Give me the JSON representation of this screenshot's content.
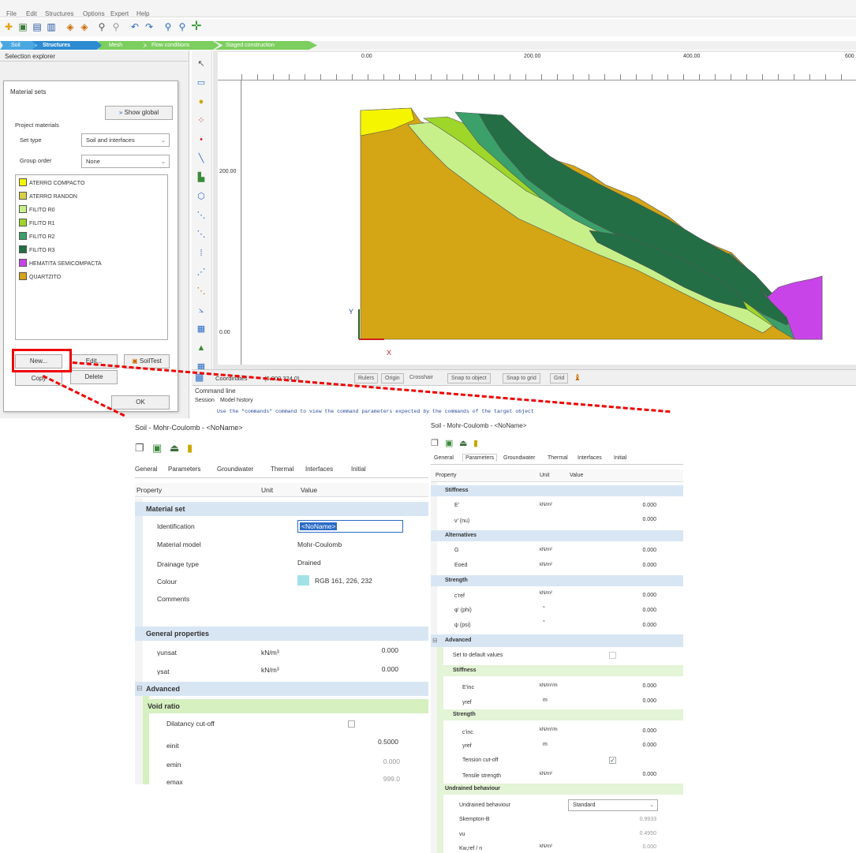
{
  "menu": [
    "File",
    "Edit",
    "Structures",
    "Options",
    "Expert",
    "Help"
  ],
  "phases": [
    "Soil",
    "Structures",
    "Mesh",
    "Flow conditions",
    "Staged construction"
  ],
  "sel_explorer": "Selection explorer",
  "dialog": {
    "title": "Material sets",
    "show_global": "Show global",
    "project_materials": "Project materials",
    "set_type_label": "Set type",
    "set_type_value": "Soil and interfaces",
    "group_order_label": "Group order",
    "group_order_value": "None",
    "new": "New...",
    "edit": "Edit...",
    "soiltest": "SoilTest",
    "copy": "Copy",
    "delete": "Delete",
    "ok": "OK"
  },
  "materials": [
    {
      "name": "ATERRO COMPACTO",
      "color": "#f5f500"
    },
    {
      "name": "ATERRO RANDON",
      "color": "#d6cf4a"
    },
    {
      "name": "FILITO R0",
      "color": "#c8f08a"
    },
    {
      "name": "FILITO R1",
      "color": "#9ed62a"
    },
    {
      "name": "FILITO R2",
      "color": "#3ba06a"
    },
    {
      "name": "FILITO R3",
      "color": "#236e44"
    },
    {
      "name": "HEMATITA SEMICOMPACTA",
      "color": "#c844e8"
    },
    {
      "name": "QUARTZITO",
      "color": "#d4a514"
    }
  ],
  "ruler": {
    "x0": "0.00",
    "x1": "200.00",
    "x2": "400.00",
    "x3": "600",
    "y1": "200.00",
    "y0": "0.00"
  },
  "axis": {
    "x": "X",
    "y": "Y"
  },
  "status": {
    "coord_label": "Coordinates",
    "coord_value": "(6.000 324.0)",
    "buttons": [
      "Rulers",
      "Origin",
      "Crosshair",
      "Snap to object",
      "Snap to grid",
      "Grid"
    ]
  },
  "cmd": {
    "title": "Command line",
    "tab1": "Session",
    "tab2": "Model history",
    "hint": "Use the \"commands\" command to view the command parameters expected by the commands of the target object"
  },
  "left_panel": {
    "title": "Soil - Mohr-Coulomb - <NoName>",
    "tabs": [
      "General",
      "Parameters",
      "Groundwater",
      "Thermal",
      "Interfaces",
      "Initial"
    ],
    "hdr": [
      "Property",
      "Unit",
      "Value"
    ],
    "material_set": "Material set",
    "rows": [
      [
        "Identification",
        "",
        "<NoName>"
      ],
      [
        "Material model",
        "",
        "Mohr-Coulomb"
      ],
      [
        "Drainage type",
        "",
        "Drained"
      ],
      [
        "Colour",
        "",
        "RGB 161, 226, 232"
      ],
      [
        "Comments",
        "",
        ""
      ]
    ],
    "general_props": "General properties",
    "gp": [
      [
        "γunsat",
        "kN/m³",
        "0.000"
      ],
      [
        "γsat",
        "kN/m³",
        "0.000"
      ]
    ],
    "advanced": "Advanced",
    "void": "Void ratio",
    "vr": [
      [
        "Dilatancy cut-off",
        "",
        ""
      ],
      [
        "einit",
        "",
        "0.5000"
      ],
      [
        "emin",
        "",
        "0.000"
      ],
      [
        "emax",
        "",
        "999.0"
      ]
    ]
  },
  "right_panel": {
    "title": "Soil - Mohr-Coulomb - <NoName>",
    "tabs": [
      "General",
      "Parameters",
      "Groundwater",
      "Thermal",
      "Interfaces",
      "Initial"
    ],
    "hdr": [
      "Property",
      "Unit",
      "Value"
    ],
    "stiffness": "Stiffness",
    "st": [
      [
        "E'",
        "kN/m²",
        "0.000"
      ],
      [
        "ν' (nu)",
        "",
        "0.000"
      ]
    ],
    "alternatives": "Alternatives",
    "al": [
      [
        "G",
        "kN/m²",
        "0.000"
      ],
      [
        "Eoed",
        "kN/m²",
        "0.000"
      ]
    ],
    "strength": "Strength",
    "sr": [
      [
        "c'ref",
        "kN/m²",
        "0.000"
      ],
      [
        "φ' (phi)",
        "°",
        "0.000"
      ],
      [
        "ψ (psi)",
        "°",
        "0.000"
      ]
    ],
    "advanced": "Advanced",
    "set_default": "Set to default values",
    "adv_stiff": "Stiffness",
    "as": [
      [
        "E'inc",
        "kN/m²/m",
        "0.000"
      ],
      [
        "yref",
        "m",
        "0.000"
      ]
    ],
    "adv_str": "Strength",
    "ast": [
      [
        "c'inc",
        "kN/m²/m",
        "0.000"
      ],
      [
        "yref",
        "m",
        "0.000"
      ],
      [
        "Tension cut-off",
        "",
        ""
      ],
      [
        "Tensile strength",
        "kN/m²",
        "0.000"
      ]
    ],
    "undrained": "Undrained behaviour",
    "ud": [
      [
        "Undrained behaviour",
        "",
        "Standard"
      ],
      [
        "Skempton-B",
        "",
        "0.9933"
      ],
      [
        "νu",
        "",
        "0.4950"
      ],
      [
        "Kw,ref / n",
        "kN/m²",
        "0.000"
      ]
    ]
  }
}
